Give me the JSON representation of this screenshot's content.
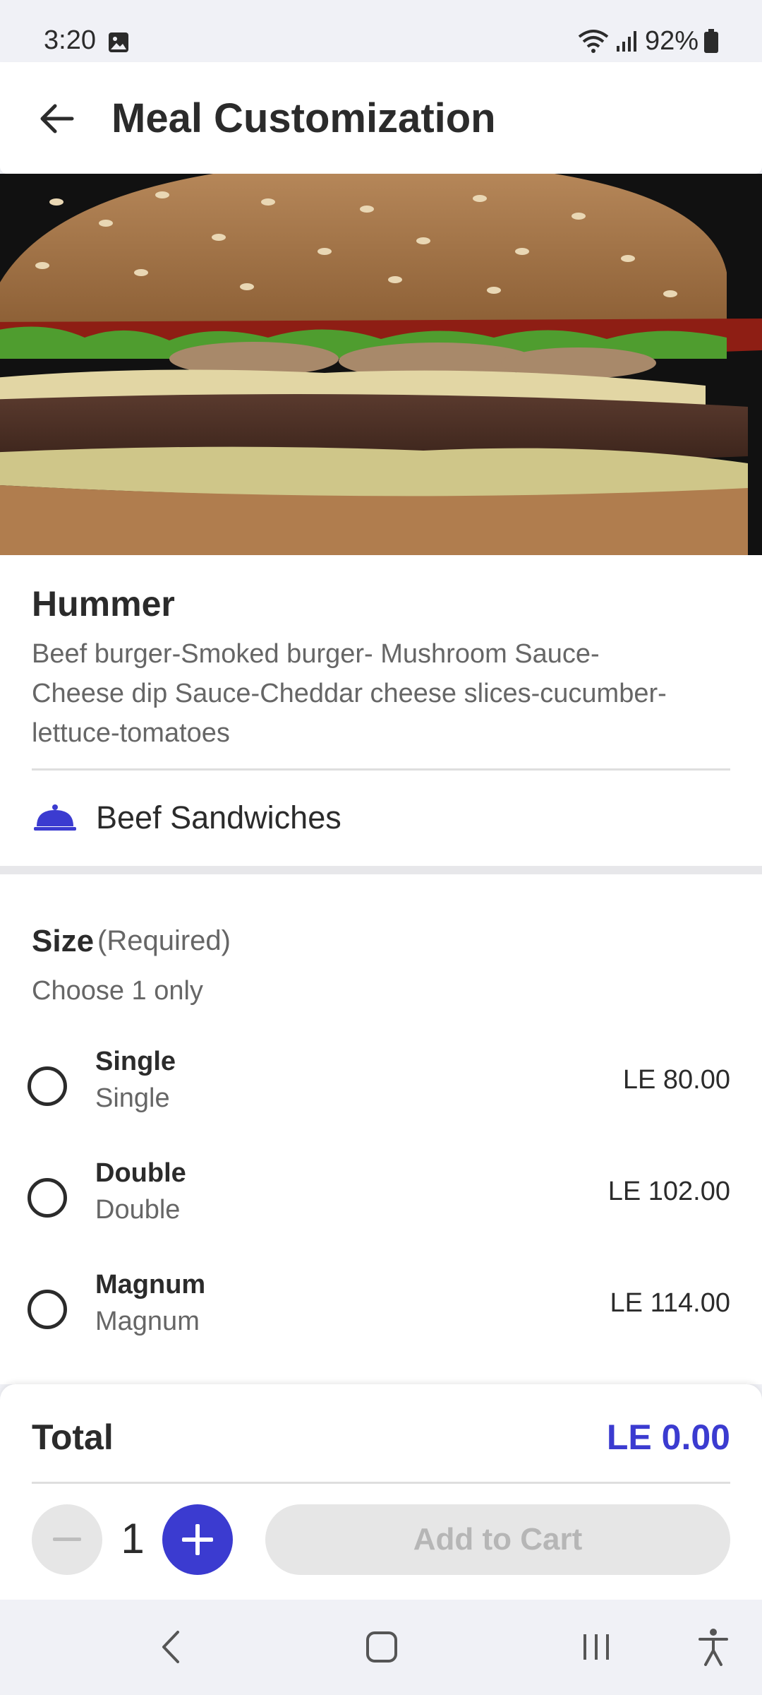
{
  "status_bar": {
    "time": "3:20",
    "battery": "92%"
  },
  "app_bar": {
    "title": "Meal Customization"
  },
  "item": {
    "name": "Hummer",
    "description": "Beef burger-Smoked burger- Mushroom Sauce-Cheese dip Sauce-Cheddar cheese slices-cucumber-lettuce-tomatoes",
    "category": "Beef Sandwiches"
  },
  "size": {
    "title": "Size",
    "required": "(Required)",
    "hint": "Choose 1 only",
    "options": [
      {
        "name": "Single",
        "sub": "Single",
        "price": "LE 80.00"
      },
      {
        "name": "Double",
        "sub": "Double",
        "price": "LE 102.00"
      },
      {
        "name": "Magnum",
        "sub": "Magnum",
        "price": "LE 114.00"
      }
    ]
  },
  "bottom": {
    "total_label": "Total",
    "total_value": "LE 0.00",
    "quantity": "1",
    "add_to_cart": "Add to Cart"
  },
  "colors": {
    "accent": "#3b3bd0",
    "disabled": "#e6e6e6"
  }
}
